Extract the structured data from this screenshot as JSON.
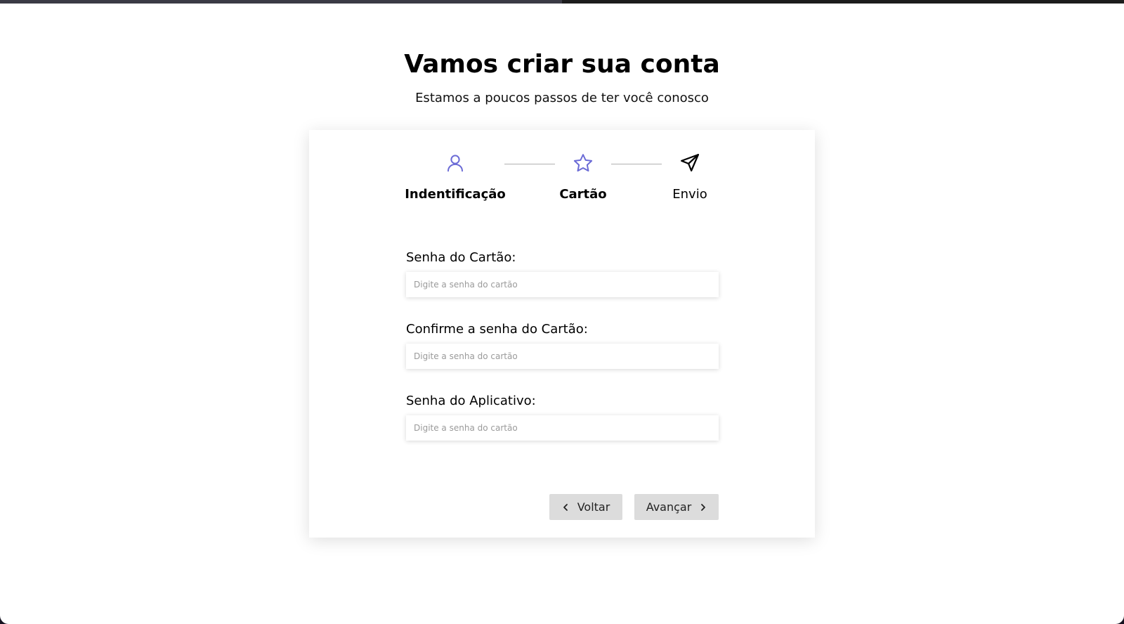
{
  "header": {
    "title": "Vamos criar sua conta",
    "subtitle": "Estamos a poucos passos de ter você conosco"
  },
  "progress": {
    "fraction": 0.5
  },
  "stepper": {
    "steps": [
      {
        "label": "Indentificação",
        "icon": "user-icon",
        "state": "completed",
        "color": "#6b6bd6"
      },
      {
        "label": "Cartão",
        "icon": "star-icon",
        "state": "current",
        "color": "#6b6bd6"
      },
      {
        "label": "Envio",
        "icon": "send-icon",
        "state": "pending",
        "color": "#000000"
      }
    ]
  },
  "form": {
    "fields": [
      {
        "label": "Senha do Cartão:",
        "placeholder": "Digite a senha do cartão",
        "value": ""
      },
      {
        "label": "Confirme a senha do Cartão:",
        "placeholder": "Digite a senha do cartão",
        "value": ""
      },
      {
        "label": "Senha do Aplicativo:",
        "placeholder": "Digite a senha do cartão",
        "value": ""
      }
    ]
  },
  "actions": {
    "back_label": "Voltar",
    "back_icon": "chevron-left-icon",
    "next_label": "Avançar",
    "next_icon": "chevron-right-icon"
  },
  "colors": {
    "accent": "#6b6bd6",
    "button_bg": "#dcdcdc",
    "page_bg": "#ffffff"
  }
}
